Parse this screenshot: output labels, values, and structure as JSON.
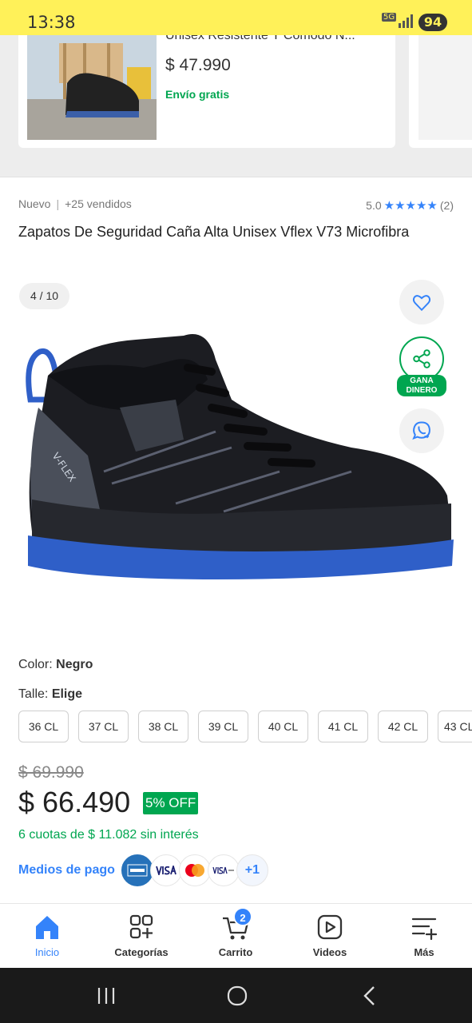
{
  "status_bar": {
    "time": "13:38",
    "network": "5G",
    "battery": "94"
  },
  "recommended_card": {
    "title": "Unisex Resistente Y Cómodo N...",
    "price": "$ 47.990",
    "shipping": "Envío gratis"
  },
  "product": {
    "condition": "Nuevo",
    "sold": "+25 vendidos",
    "rating": "5.0",
    "reviews": "(2)",
    "title": "Zapatos De Seguridad Caña Alta Unisex Vflex V73 Microfibra"
  },
  "gallery": {
    "counter": "4 / 10",
    "share_label_line1": "GANA",
    "share_label_line2": "DINERO",
    "brand_mark": "V-FLEX"
  },
  "options": {
    "color_label": "Color:",
    "color_value": "Negro",
    "size_label": "Talle:",
    "size_value": "Elige",
    "sizes": [
      "36 CL",
      "37 CL",
      "38 CL",
      "39 CL",
      "40 CL",
      "41 CL",
      "42 CL",
      "43 CL"
    ]
  },
  "pricing": {
    "old_price": "$ 69.990",
    "price": "$ 66.490",
    "discount": "5% OFF",
    "installments": "6 cuotas de $ 11.082 sin interés",
    "payment_label": "Medios de pago",
    "payment_more": "+1",
    "payment_methods": [
      "american-express",
      "visa",
      "mastercard",
      "visa-debito"
    ]
  },
  "bottom_nav": {
    "items": [
      {
        "label": "Inicio",
        "icon": "home-icon"
      },
      {
        "label": "Categorías",
        "icon": "categories-icon"
      },
      {
        "label": "Carrito",
        "icon": "cart-icon"
      },
      {
        "label": "Videos",
        "icon": "video-icon"
      },
      {
        "label": "Más",
        "icon": "more-icon"
      }
    ],
    "cart_count": "2"
  },
  "colors": {
    "brand_yellow": "#fff159",
    "accent_blue": "#3483fa",
    "success_green": "#00a650"
  }
}
